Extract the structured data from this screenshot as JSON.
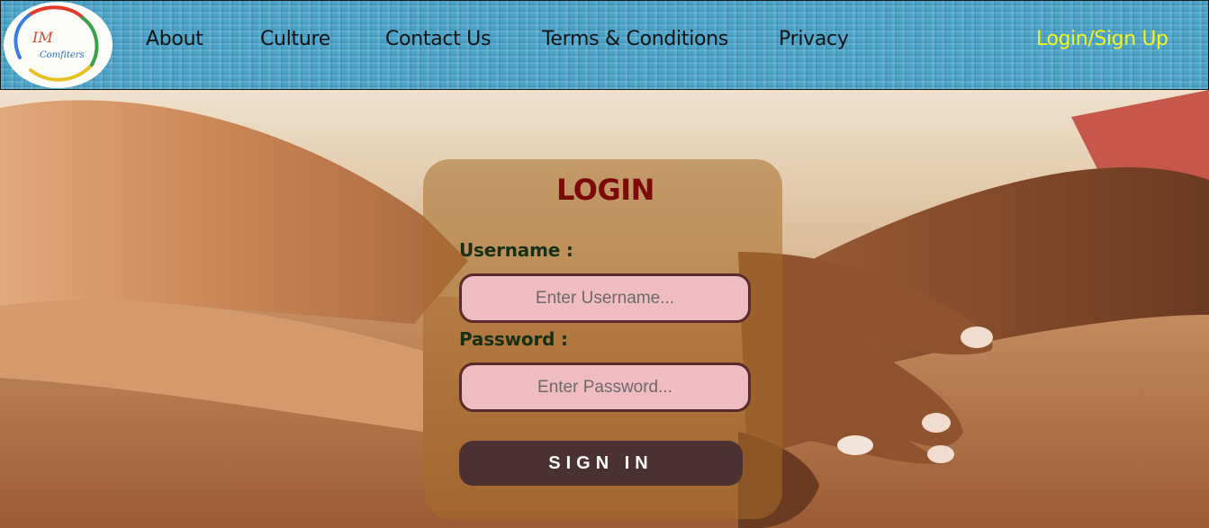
{
  "logo": {
    "icon": "company-logo",
    "text_top": "IM",
    "text_bottom": "Comfiters"
  },
  "nav": {
    "links": [
      "About",
      "Culture",
      "Contact Us",
      "Terms & Conditions",
      "Privacy"
    ],
    "login": "Login/Sign Up"
  },
  "login_card": {
    "title": "LOGIN",
    "username_label": "Username :",
    "username_placeholder": "Enter Username...",
    "password_label": "Password :",
    "password_placeholder": "Enter Password...",
    "submit_label": "SIGN IN"
  },
  "colors": {
    "nav_bg": "#4aa3c9",
    "login_link": "#f3f51c",
    "title": "#7d0a0a",
    "label": "#163016",
    "input_bg": "#efbcc1",
    "input_border": "#5a2a2d",
    "button_bg": "#4c3133"
  },
  "background_image": "holding-hands-photo"
}
